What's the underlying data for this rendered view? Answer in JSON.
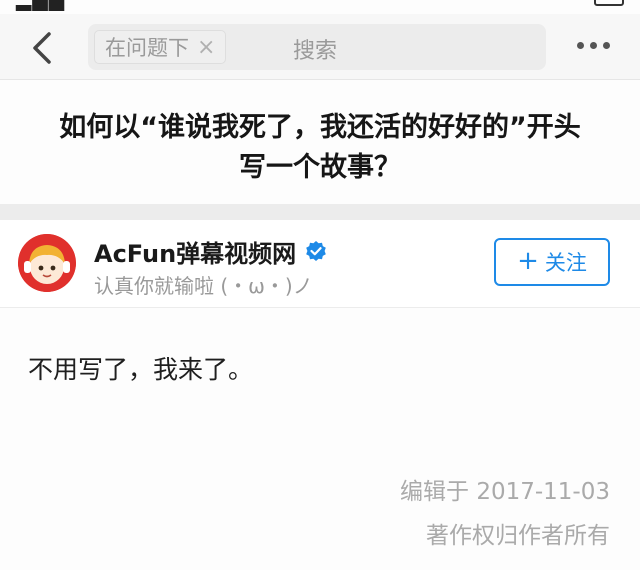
{
  "nav": {
    "scope_chip": "在问题下",
    "scope_clear": "×",
    "search_label": "搜索"
  },
  "question": {
    "line1": "如何以“谁说我死了，我还活的好好的”开头",
    "line2": "写一个故事？"
  },
  "author": {
    "name": "AcFun弹幕视频网",
    "bio": "认真你就输啦 (・ω・)ノ",
    "follow_plus": "+",
    "follow_label": "关注"
  },
  "answer": {
    "text": "不用写了，我来了。",
    "edited": "编辑于 2017-11-03",
    "copyright": "著作权归作者所有"
  },
  "colors": {
    "accent": "#1e8ae7",
    "avatar_bg": "#e0302c",
    "muted_text": "#aaaaaa"
  },
  "icons": {
    "back": "chevron-left-icon",
    "more": "more-dots-icon",
    "verified": "verified-badge-icon",
    "clear": "close-icon"
  }
}
